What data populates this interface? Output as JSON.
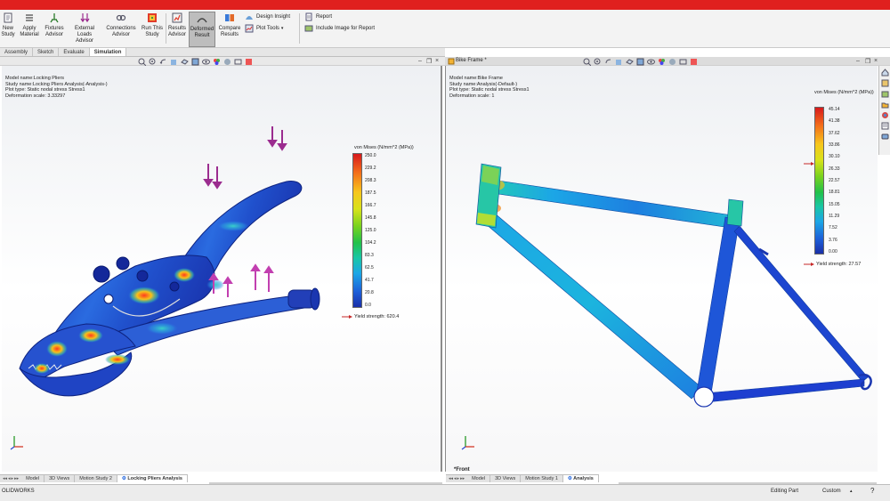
{
  "ribbon": {
    "buttons": [
      {
        "label1": "New",
        "label2": "Study",
        "icon": "new-study-icon"
      },
      {
        "label1": "Apply",
        "label2": "Material",
        "icon": "apply-material-icon"
      },
      {
        "label1": "Fixtures",
        "label2": "Advisor",
        "icon": "fixtures-advisor-icon"
      },
      {
        "label1": "External Loads",
        "label2": "Advisor",
        "icon": "external-loads-icon"
      },
      {
        "label1": "Connections",
        "label2": "Advisor",
        "icon": "connections-advisor-icon"
      },
      {
        "label1": "Run This",
        "label2": "Study",
        "icon": "run-study-icon"
      },
      {
        "label1": "Results",
        "label2": "Advisor",
        "icon": "results-advisor-icon"
      },
      {
        "label1": "Deformed",
        "label2": "Result",
        "icon": "deformed-result-icon"
      },
      {
        "label1": "Compare",
        "label2": "Results",
        "icon": "compare-results-icon"
      }
    ],
    "design_insight": "Design Insight",
    "plot_tools": "Plot Tools",
    "report": "Report",
    "include_image": "Include Image for Report"
  },
  "command_tabs": [
    "Assembly",
    "Sketch",
    "Evaluate",
    "Simulation"
  ],
  "active_command_tab": "Simulation",
  "left_view": {
    "window_title": "",
    "info": [
      "Model name:Locking Pliers",
      "Study name:Locking Pliers Analysis(-Analysis-)",
      "Plot type: Static nodal stress Stress1",
      "Deformation scale: 3.33297"
    ],
    "legend_title": "von Mises (N/mm^2 (MPa))",
    "legend_values": [
      "250.0",
      "229.2",
      "208.3",
      "187.5",
      "166.7",
      "145.8",
      "125.0",
      "104.2",
      "83.3",
      "62.5",
      "41.7",
      "20.8",
      "0.0"
    ],
    "yield": "Yield strength: 620.4",
    "tabs": [
      "Model",
      "3D Views",
      "Motion Study 2",
      "Locking Pliers Analysis"
    ]
  },
  "right_view": {
    "window_title": "Bike Frame *",
    "info": [
      "Model name:Bike Frame",
      "Study name:Analysis(-Default-)",
      "Plot type: Static nodal stress Stress1",
      "Deformation scale: 1"
    ],
    "legend_title": "von Mises (N/mm^2 (MPa))",
    "legend_values": [
      "45.14",
      "41.38",
      "37.62",
      "33.86",
      "30.10",
      "26.33",
      "22.57",
      "18.81",
      "15.05",
      "11.29",
      "7.52",
      "3.76",
      "0.00"
    ],
    "yield": "Yield strength: 27.57",
    "tabs": [
      "Model",
      "3D Views",
      "Motion Study 1",
      "Analysis"
    ],
    "footer_label": "*Front"
  },
  "status": {
    "left": "OLIDWORKS",
    "mode": "Editing Part",
    "units": "Custom"
  },
  "colors": {
    "brand_red": "#e0201e",
    "stress_max": "#d7191c",
    "stress_min": "#1a2fa8",
    "load_arrow": "#9b2c8f"
  }
}
